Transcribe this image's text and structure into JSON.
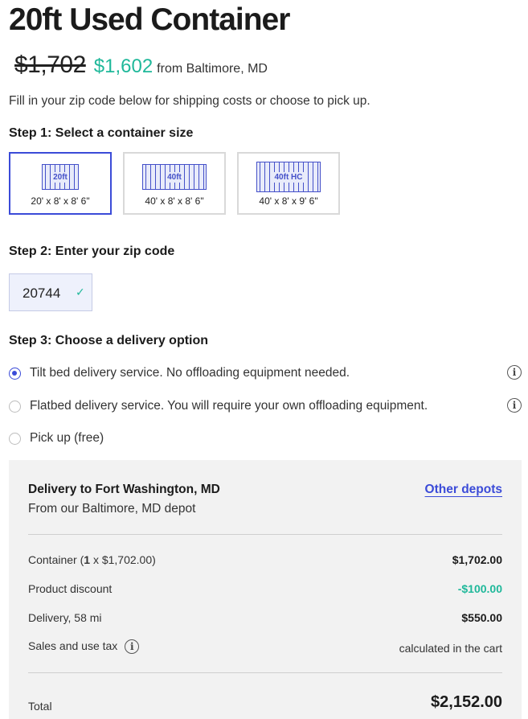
{
  "product": {
    "title": "20ft Used Container",
    "old_price": "$1,702",
    "new_price": "$1,602",
    "location": "from Baltimore, MD",
    "intro": "Fill in your zip code below for shipping costs or choose to pick up."
  },
  "step1": {
    "heading": "Step 1: Select a container size",
    "options": [
      {
        "badge": "20ft",
        "dims": "20' x 8' x 8' 6\"",
        "selected": true
      },
      {
        "badge": "40ft",
        "dims": "40' x 8' x 8' 6\"",
        "selected": false
      },
      {
        "badge": "40ft HC",
        "dims": "40' x 8' x 9' 6\"",
        "selected": false
      }
    ]
  },
  "step2": {
    "heading": "Step 2: Enter your zip code",
    "zip_value": "20744",
    "icon": "check-icon"
  },
  "step3": {
    "heading": "Step 3: Choose a delivery option",
    "options": [
      {
        "label": "Tilt bed delivery service. No offloading equipment needed.",
        "selected": true,
        "info": true
      },
      {
        "label": "Flatbed delivery service. You will require your own offloading equipment.",
        "selected": false,
        "info": true
      },
      {
        "label": "Pick up (free)",
        "selected": false,
        "info": false
      }
    ]
  },
  "summary": {
    "title": "Delivery to Fort Washington, MD",
    "subtitle": "From our Baltimore, MD depot",
    "link": "Other depots",
    "container_prefix": "Container (",
    "container_qty": "1",
    "container_suffix": " x $1,702.00)",
    "container_value": "$1,702.00",
    "discount_label": "Product discount",
    "discount_value": "-$100.00",
    "delivery_label": "Delivery, 58 mi",
    "delivery_value": "$550.00",
    "tax_label": "Sales and use tax",
    "tax_value": "calculated in the cart",
    "total_label": "Total",
    "total_value": "$2,152.00"
  },
  "colors": {
    "accent": "#3b4bd8",
    "price_green": "#1fb89a",
    "panel_bg": "#f2f2f2"
  }
}
